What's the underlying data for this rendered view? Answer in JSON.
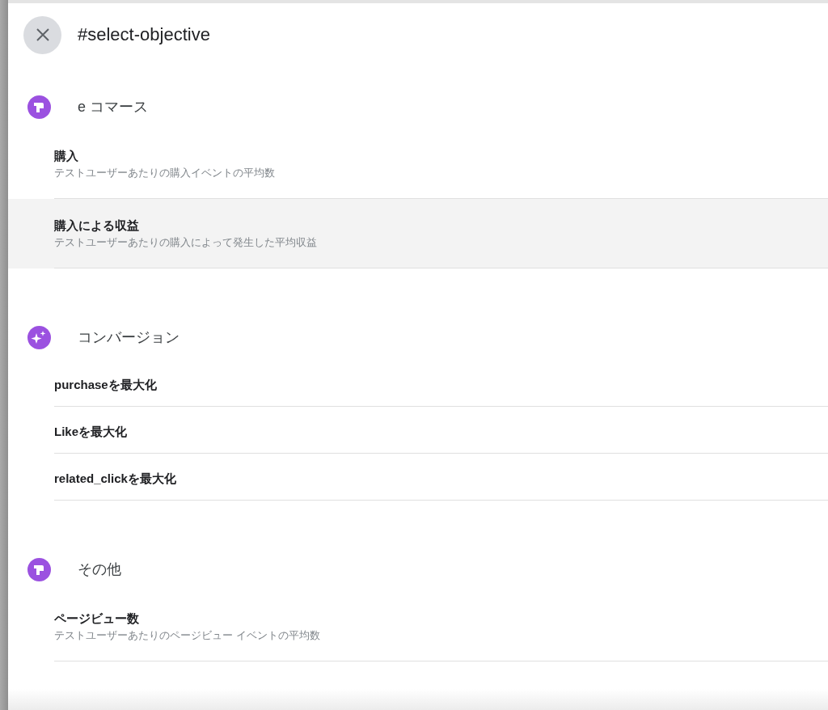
{
  "dialog": {
    "title": "#select-objective",
    "close_button": {
      "kind": "close"
    }
  },
  "sections": [
    {
      "kind": "arrow",
      "label": "e コマース",
      "items": [
        {
          "title": "購入",
          "subtitle": "テストユーザーあたりの購入イベントの平均数",
          "highlighted": false
        },
        {
          "title": "購入による収益",
          "subtitle": "テストユーザーあたりの購入によって発生した平均収益",
          "highlighted": true
        }
      ]
    },
    {
      "kind": "sparkle",
      "label": "コンバージョン",
      "items": [
        {
          "title": "purchaseを最大化",
          "highlighted": false
        },
        {
          "title": "Likeを最大化",
          "highlighted": false
        },
        {
          "title": "related_clickを最大化",
          "highlighted": false
        }
      ]
    },
    {
      "kind": "arrow",
      "label": "その他",
      "items": [
        {
          "title": "ページビュー数",
          "subtitle": "テストユーザーあたりのページビュー イベントの平均数",
          "highlighted": false
        }
      ]
    }
  ]
}
